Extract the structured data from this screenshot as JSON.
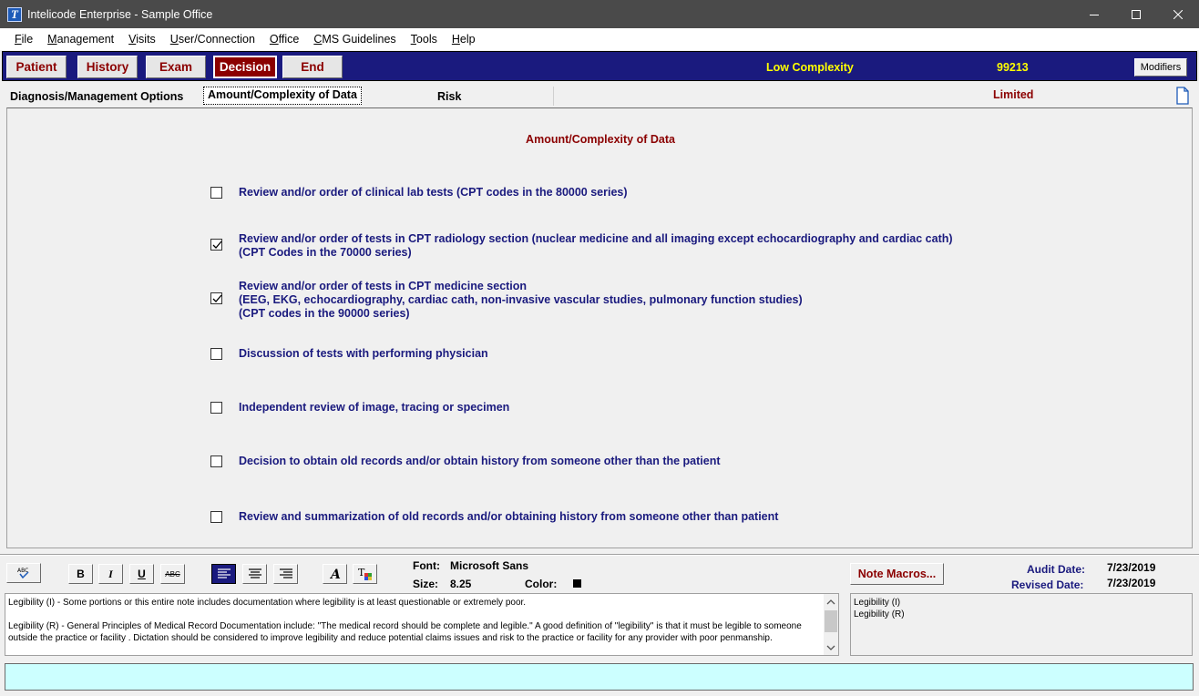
{
  "window": {
    "title": "Intelicode Enterprise  - Sample Office",
    "app_icon_letter": "T"
  },
  "menu": [
    {
      "label": "File",
      "ul": "F",
      "rest": "ile"
    },
    {
      "label": "Management",
      "ul": "M",
      "rest": "anagement"
    },
    {
      "label": "Visits",
      "ul": "V",
      "rest": "isits"
    },
    {
      "label": "User/Connection",
      "ul": "U",
      "rest": "ser/Connection"
    },
    {
      "label": "Office",
      "ul": "O",
      "rest": "ffice"
    },
    {
      "label": "CMS Guidelines",
      "ul": "C",
      "rest": "MS Guidelines"
    },
    {
      "label": "Tools",
      "ul": "T",
      "rest": "ools"
    },
    {
      "label": "Help",
      "ul": "H",
      "rest": "elp"
    }
  ],
  "nav": {
    "buttons": [
      "Patient",
      "History",
      "Exam",
      "Decision",
      "End"
    ],
    "active": "Decision",
    "complexity": "Low Complexity",
    "code": "99213",
    "modifiers": "Modifiers"
  },
  "tabs": {
    "diagnosis": "Diagnosis/Management Options",
    "data": "Amount/Complexity of Data",
    "risk": "Risk",
    "level": "Limited"
  },
  "section": {
    "title": "Amount/Complexity of Data",
    "options": [
      {
        "text": "Review and/or order of clinical lab tests (CPT codes in the 80000 series)",
        "checked": false
      },
      {
        "text": "Review and/or order of tests in CPT radiology section (nuclear medicine and all imaging except echocardiography and cardiac cath)\n(CPT Codes in the 70000 series)",
        "checked": true
      },
      {
        "text": "Review and/or order of tests in CPT medicine section\n(EEG, EKG, echocardiography, cardiac cath, non-invasive vascular studies, pulmonary function studies)\n(CPT codes in the 90000 series)",
        "checked": true
      },
      {
        "text": "Discussion of tests with performing physician",
        "checked": false
      },
      {
        "text": "Independent review of image, tracing or specimen",
        "checked": false
      },
      {
        "text": "Decision to obtain old records and/or obtain history from someone other than the patient",
        "checked": false
      },
      {
        "text": "Review and summarization of old records and/or obtaining history from someone other than patient",
        "checked": false
      }
    ]
  },
  "toolbar": {
    "bold": "B",
    "italic": "I",
    "underline": "U",
    "strike": "ABC",
    "font_label": "Font:",
    "font_value": "Microsoft Sans",
    "size_label": "Size:",
    "size_value": "8.25",
    "color_label": "Color:",
    "color_value": "#000000",
    "note_macros": "Note Macros...",
    "audit_label": "Audit Date:",
    "audit_date": "7/23/2019",
    "revised_label": "Revised Date:",
    "revised_date": "7/23/2019"
  },
  "note": {
    "paragraphs": [
      "Legibility (I) - Some portions or this entire note includes documentation where legibility is at least questionable or extremely poor.",
      "Legibility (R) - General Principles of Medical Record Documentation include: \"The medical record should be complete and legible.\"  A good definition of \"legibility\" is that it must be legible to someone outside the practice or facility .  Dictation should be considered to improve legibility and reduce potential claims issues and risk to the practice or facility for any provider with poor penmanship."
    ]
  },
  "macros": [
    "Legibility (I)",
    "Legibility (R)"
  ]
}
